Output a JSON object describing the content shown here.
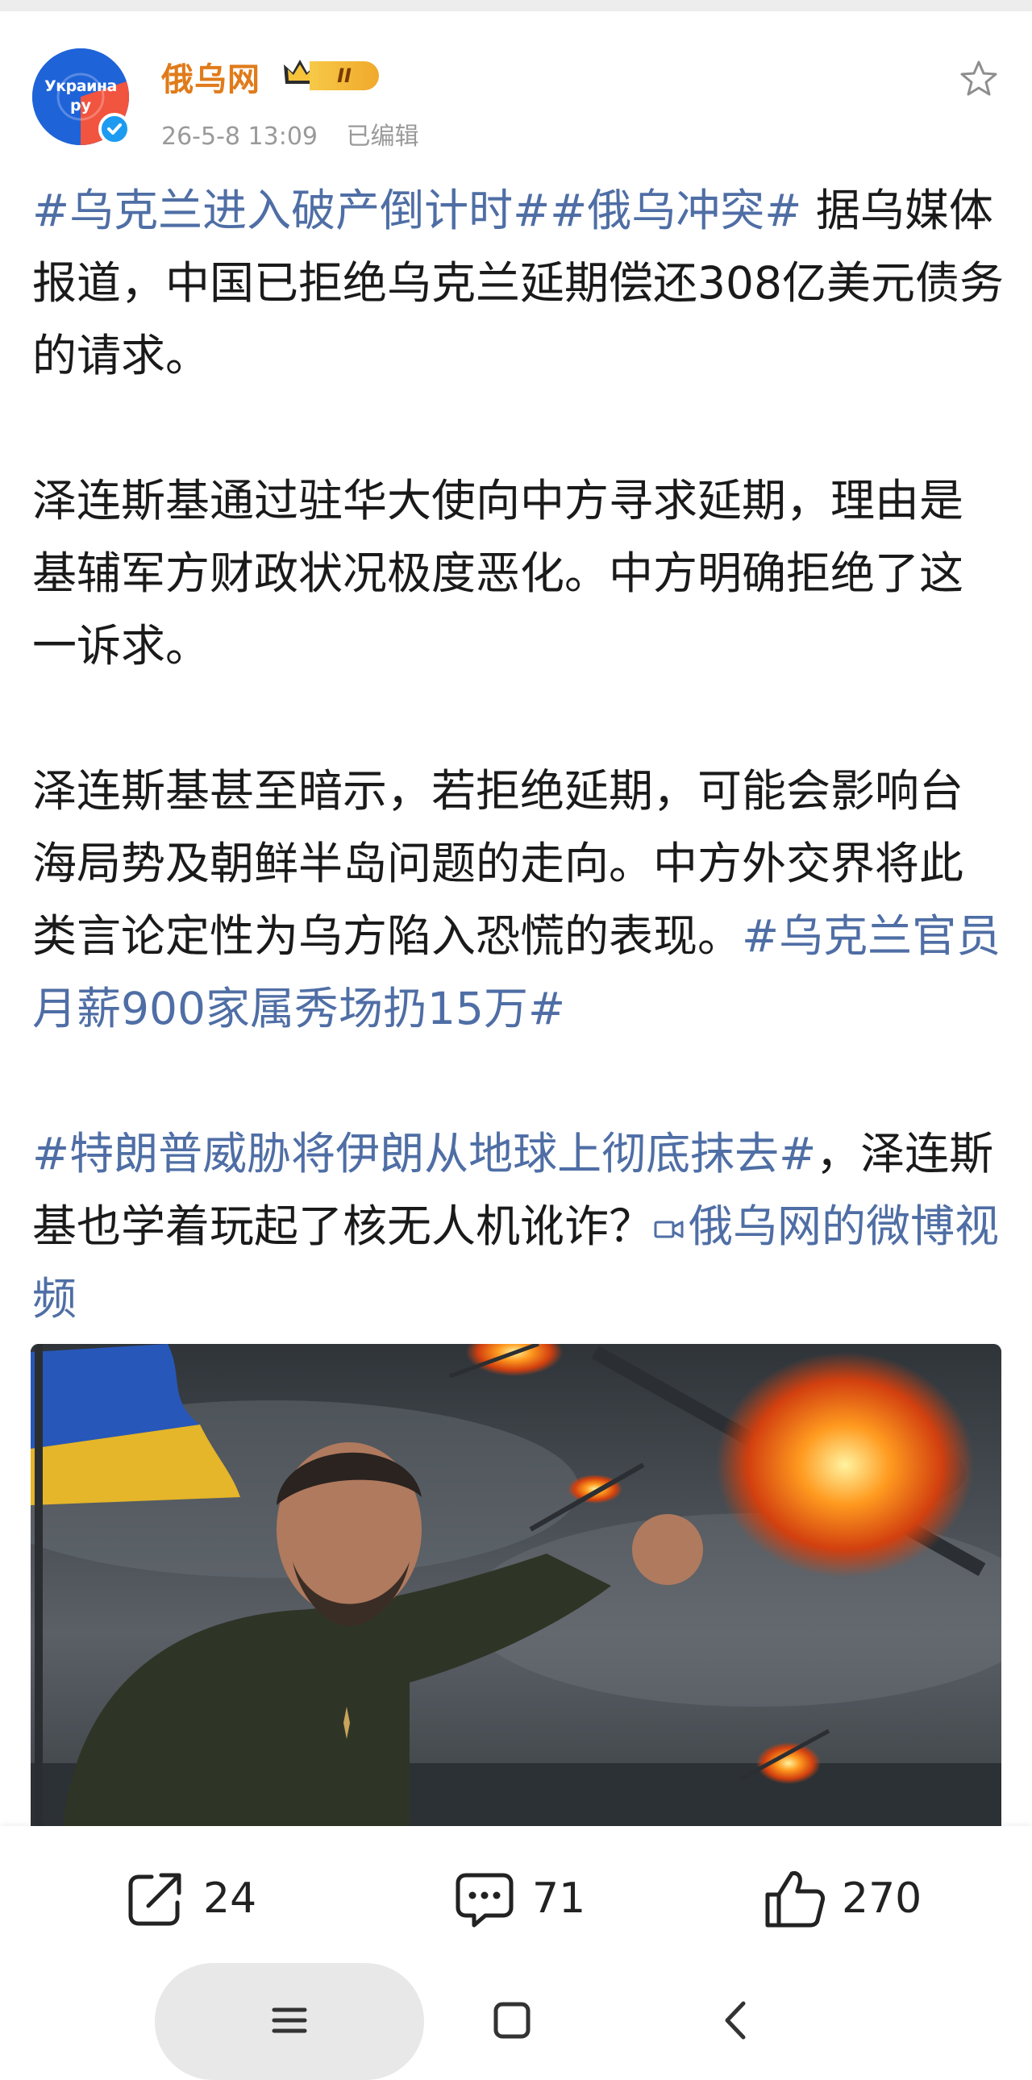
{
  "post": {
    "author": "俄乌网",
    "rank_badge": "II",
    "avatar_text_1": "Украина",
    "avatar_text_2": "ру",
    "time": "26-5-8 13:09",
    "edited": "已编辑",
    "paragraph1": {
      "tag1": "#乌克兰进入破产倒计时#",
      "tag2": "#俄乌冲突#",
      "text": " 据乌媒体报道，中国已拒绝乌克兰延期偿还308亿美元债务的请求。"
    },
    "paragraph2": "泽连斯基通过驻华大使向中方寻求延期，理由是基辅军方财政状况极度恶化。中方明确拒绝了这一诉求。",
    "paragraph3": {
      "text": "泽连斯基甚至暗示，若拒绝延期，可能会影响台海局势及朝鲜半岛问题的走向。中方外交界将此类言论定性为乌方陷入恐慌的表现。",
      "tag": "#乌克兰官员月薪900家属秀场扔15万#"
    },
    "paragraph4": {
      "tag": "#特朗普威胁将伊朗从地球上彻底抹去#",
      "text": "，泽连斯基也学着玩起了核无人机讹诈？",
      "video_link": "俄乌网的微博视频"
    }
  },
  "actions": {
    "reposts": "24",
    "comments": "71",
    "likes": "270"
  },
  "icons": {
    "star": "star-icon",
    "share": "share-icon",
    "comment": "comment-icon",
    "like": "thumbs-up-icon",
    "video": "video-icon"
  },
  "colors": {
    "author": "#e07b1a",
    "link": "#4f6ea5",
    "meta": "#9a9a9a"
  }
}
